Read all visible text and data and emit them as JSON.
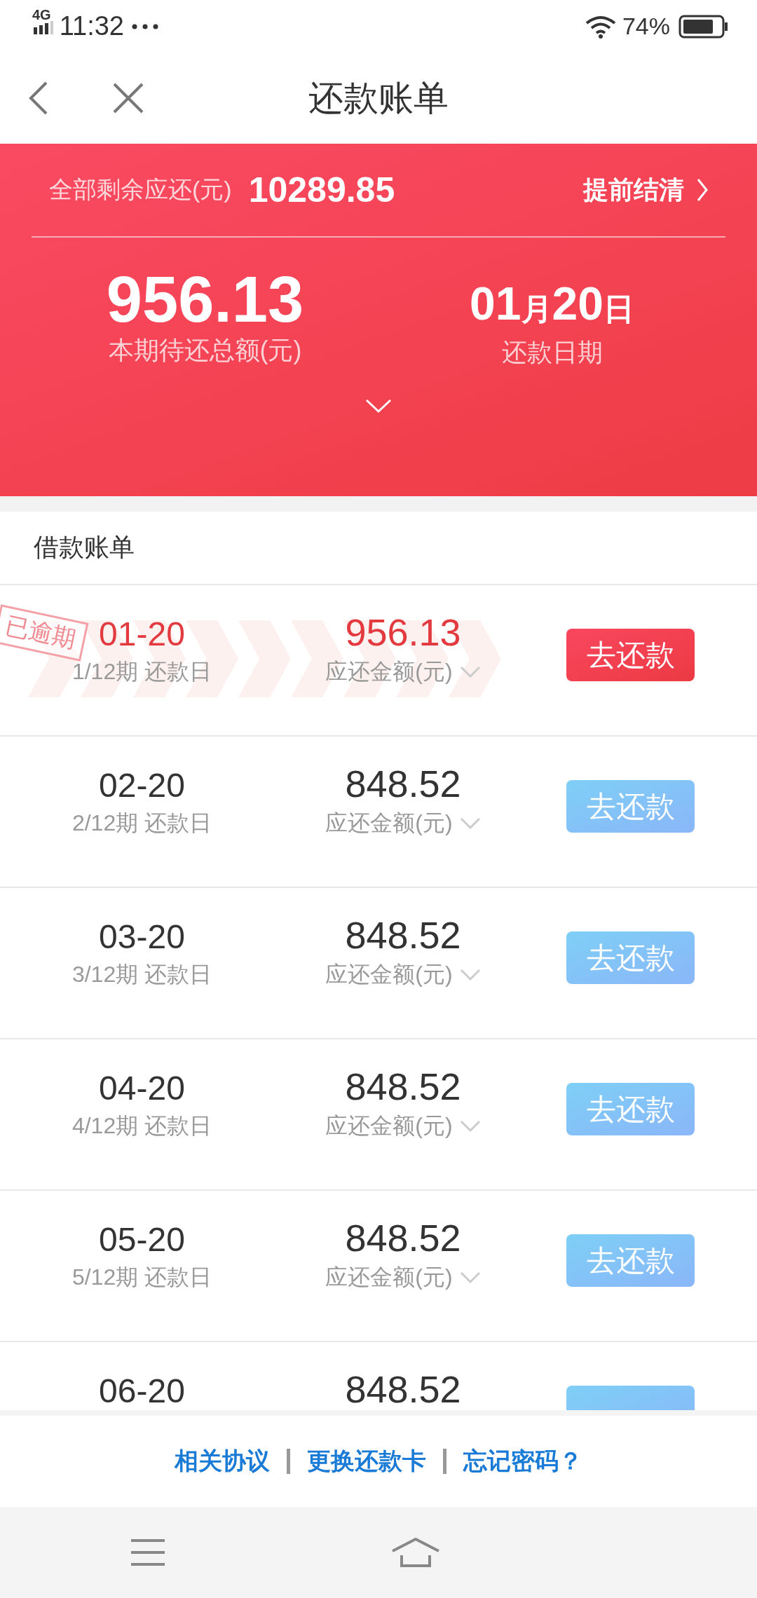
{
  "status_bar": {
    "network": "4G",
    "time": "11:32",
    "battery": "74%"
  },
  "nav": {
    "title": "还款账单"
  },
  "summary": {
    "total_label": "全部剩余应还(元)",
    "total_value": "10289.85",
    "settle_link": "提前结清",
    "current_amount": "956.13",
    "current_label": "本期待还总额(元)",
    "date": {
      "month": "01",
      "month_unit": "月",
      "day": "20",
      "day_unit": "日"
    },
    "date_label": "还款日期"
  },
  "section": {
    "title": "借款账单"
  },
  "rows": [
    {
      "date": "01-20",
      "period": "1/12期 还款日",
      "amount": "956.13",
      "amount_label": "应还金额(元)",
      "button": "去还款",
      "overdue": true,
      "stamp": "已逾期"
    },
    {
      "date": "02-20",
      "period": "2/12期 还款日",
      "amount": "848.52",
      "amount_label": "应还金额(元)",
      "button": "去还款",
      "overdue": false
    },
    {
      "date": "03-20",
      "period": "3/12期 还款日",
      "amount": "848.52",
      "amount_label": "应还金额(元)",
      "button": "去还款",
      "overdue": false
    },
    {
      "date": "04-20",
      "period": "4/12期 还款日",
      "amount": "848.52",
      "amount_label": "应还金额(元)",
      "button": "去还款",
      "overdue": false
    },
    {
      "date": "05-20",
      "period": "5/12期 还款日",
      "amount": "848.52",
      "amount_label": "应还金额(元)",
      "button": "去还款",
      "overdue": false
    },
    {
      "date": "06-20",
      "amount": "848.52",
      "overdue": false
    }
  ],
  "footer_links": [
    "相关协议",
    "更换还款卡",
    "忘记密码？"
  ]
}
